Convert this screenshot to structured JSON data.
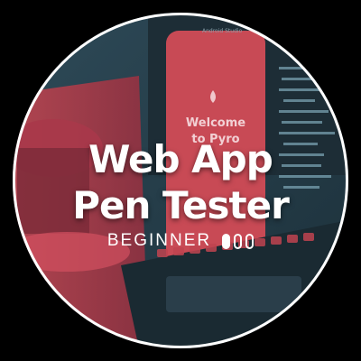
{
  "badge": {
    "title_line1": "Web App",
    "title_line2": "Pen Tester",
    "level_label": "BEGINNER",
    "level_filled": 1,
    "level_total": 3
  },
  "phone_screen": {
    "app_label": "Android Studio",
    "welcome_line1": "Welcome",
    "welcome_line2": "to Pyro"
  },
  "colors": {
    "background": "#000000",
    "ring": "#ffffff",
    "scene_dark": "#243c48",
    "scene_red": "#c0404a",
    "text": "#ffffff"
  }
}
